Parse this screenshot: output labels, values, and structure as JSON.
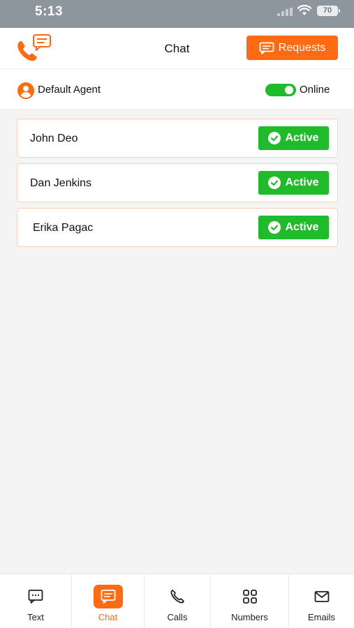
{
  "status_bar": {
    "time": "5:13",
    "battery": "70"
  },
  "header": {
    "title": "Chat",
    "requests_label": "Requests",
    "logo_icon": "phone-chat-icon"
  },
  "agent": {
    "name": "Default Agent",
    "status_label": "Online",
    "online": true
  },
  "chats": [
    {
      "name": "John Deo",
      "status": "Active"
    },
    {
      "name": "Dan Jenkins",
      "status": "Active"
    },
    {
      "name": "Erika Pagac",
      "status": "Active"
    }
  ],
  "tabs": [
    {
      "label": "Text",
      "icon": "message-icon",
      "active": false
    },
    {
      "label": "Chat",
      "icon": "chat-icon",
      "active": true
    },
    {
      "label": "Calls",
      "icon": "phone-icon",
      "active": false
    },
    {
      "label": "Numbers",
      "icon": "grid-icon",
      "active": false
    },
    {
      "label": "Emails",
      "icon": "mail-icon",
      "active": false
    }
  ],
  "colors": {
    "accent": "#ff6a13",
    "active_green": "#1fbb2a",
    "card_border": "#f7d4bf"
  }
}
